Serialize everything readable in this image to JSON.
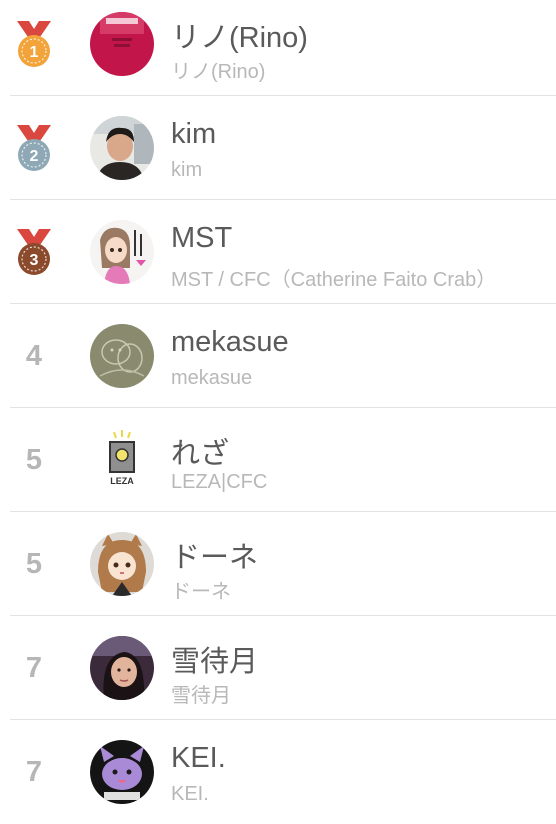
{
  "ranking": {
    "rows": [
      {
        "rank": "1",
        "medal": "gold",
        "name": "リノ(Rino)",
        "subtitle": "リノ(Rino)"
      },
      {
        "rank": "2",
        "medal": "silver",
        "name": "kim",
        "subtitle": "kim"
      },
      {
        "rank": "3",
        "medal": "bronze",
        "name": "MST",
        "subtitle": "MST / CFC（Catherine Faito Crab）"
      },
      {
        "rank": "4",
        "medal": "",
        "name": "mekasue",
        "subtitle": "mekasue"
      },
      {
        "rank": "5",
        "medal": "",
        "name": "れざ",
        "subtitle": "LEZA|CFC"
      },
      {
        "rank": "5",
        "medal": "",
        "name": "ドーネ",
        "subtitle": "ドーネ"
      },
      {
        "rank": "7",
        "medal": "",
        "name": "雪待月",
        "subtitle": "雪待月"
      },
      {
        "rank": "7",
        "medal": "",
        "name": "KEI.",
        "subtitle": "KEI."
      }
    ]
  },
  "avatar_text": {
    "leza": "LEZA"
  },
  "colors": {
    "gold": "#f2a43b",
    "silver": "#8fa8b6",
    "bronze": "#8a4a2b",
    "ribbon": "#d9473f",
    "rank_text": "#b6b6b6",
    "name_text": "#5a5a5a",
    "subtitle_text": "#b8b8b8",
    "divider": "#e3e3e3"
  }
}
